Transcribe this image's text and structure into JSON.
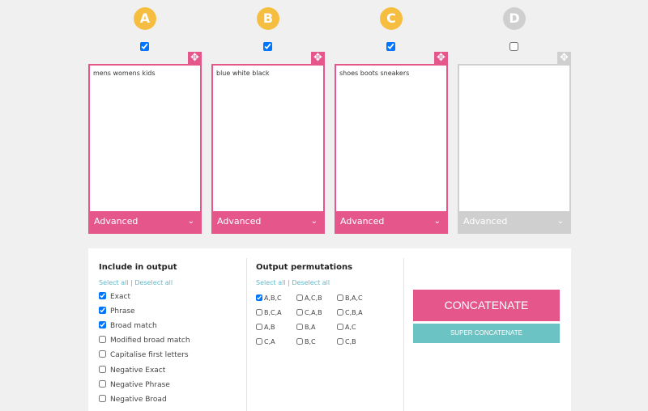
{
  "columns": [
    {
      "letter": "A",
      "checked": true,
      "keywords": "mens womens kids",
      "advanced_label": "Advanced",
      "move_icon": "move-arrows-icon",
      "chevron_icon": "chevron-down-icon"
    },
    {
      "letter": "B",
      "checked": true,
      "keywords": "blue white black",
      "advanced_label": "Advanced",
      "move_icon": "move-arrows-icon",
      "chevron_icon": "chevron-down-icon"
    },
    {
      "letter": "C",
      "checked": true,
      "keywords": "shoes boots sneakers",
      "advanced_label": "Advanced",
      "move_icon": "move-arrows-icon",
      "chevron_icon": "chevron-down-icon"
    },
    {
      "letter": "D",
      "checked": false,
      "keywords": "",
      "advanced_label": "Advanced",
      "move_icon": "move-arrows-icon",
      "chevron_icon": "chevron-down-icon"
    }
  ],
  "output_options": {
    "title": "Include in output",
    "select_all": "Select all",
    "separator": "|",
    "deselect_all": "Deselect all",
    "items": [
      {
        "label": "Exact",
        "checked": true
      },
      {
        "label": "Phrase",
        "checked": true
      },
      {
        "label": "Broad match",
        "checked": true
      },
      {
        "label": "Modified broad match",
        "checked": false
      },
      {
        "label": "Capitalise first letters",
        "checked": false
      },
      {
        "label": "Negative Exact",
        "checked": false
      },
      {
        "label": "Negative Phrase",
        "checked": false
      },
      {
        "label": "Negative Broad",
        "checked": false
      }
    ]
  },
  "permutations": {
    "title": "Output permutations",
    "select_all": "Select all",
    "separator": "|",
    "deselect_all": "Deselect all",
    "rows": [
      [
        {
          "label": "A,B,C",
          "checked": true
        },
        {
          "label": "A,C,B",
          "checked": false
        },
        {
          "label": "B,A,C",
          "checked": false
        }
      ],
      [
        {
          "label": "B,C,A",
          "checked": false
        },
        {
          "label": "C,A,B",
          "checked": false
        },
        {
          "label": "C,B,A",
          "checked": false
        }
      ],
      [
        {
          "label": "A,B",
          "checked": false
        },
        {
          "label": "B,A",
          "checked": false
        },
        {
          "label": "A,C",
          "checked": false
        }
      ],
      [
        {
          "label": "C,A",
          "checked": false
        },
        {
          "label": "B,C",
          "checked": false
        },
        {
          "label": "C,B",
          "checked": false
        }
      ]
    ]
  },
  "actions": {
    "concatenate_label": "CONCATENATE",
    "super_concatenate_label": "SUPER CONCATENATE"
  },
  "colors": {
    "accent_pink": "#e5568a",
    "letter_yellow": "#f6be41",
    "disabled_grey": "#cfcfcf",
    "teal": "#6cc3c3"
  }
}
